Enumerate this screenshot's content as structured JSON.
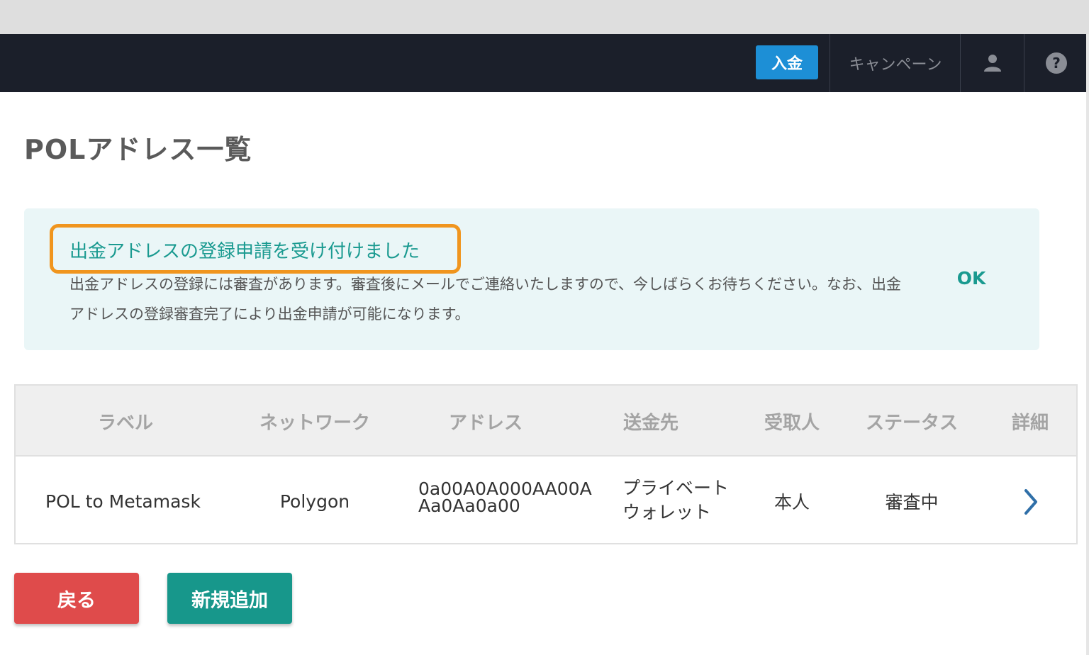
{
  "header": {
    "deposit_label": "入金",
    "campaign_label": "キャンペーン",
    "user_icon": "user-icon",
    "help_icon": "help-icon"
  },
  "page": {
    "title": "POLアドレス一覧"
  },
  "alert": {
    "title": "出金アドレスの登録申請を受け付けました",
    "body": "出金アドレスの登録には審査があります。審査後にメールでご連絡いたしますので、今しばらくお待ちください。なお、出金アドレスの登録審査完了により出金申請が可能になります。",
    "ok_label": "OK"
  },
  "table": {
    "headers": {
      "label": "ラベル",
      "network": "ネットワーク",
      "address": "アドレス",
      "destination": "送金先",
      "recipient": "受取人",
      "status": "ステータス",
      "detail": "詳細"
    },
    "rows": [
      {
        "label": "POL to Metamask",
        "network": "Polygon",
        "address": "0a00A0A000AA00AAa0Aa0a00",
        "destination": "プライベートウォレット",
        "recipient": "本人",
        "status": "審査中"
      }
    ]
  },
  "actions": {
    "back_label": "戻る",
    "add_label": "新規追加"
  },
  "colors": {
    "navbar": "#1b1f2a",
    "deposit": "#1d8fd6",
    "accent_teal": "#17978b",
    "danger": "#df4b4b",
    "highlight": "#f0951e",
    "alert_bg": "#eaf6f7"
  }
}
